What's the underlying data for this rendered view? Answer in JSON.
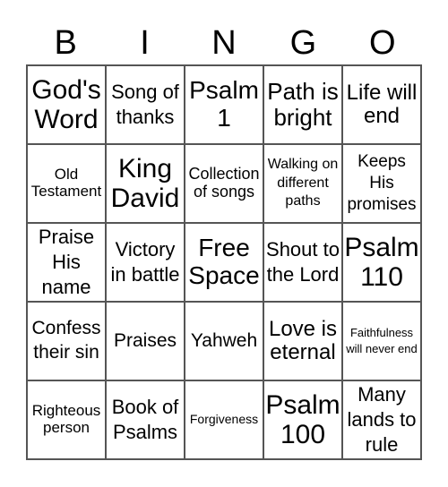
{
  "header": [
    "B",
    "I",
    "N",
    "G",
    "O"
  ],
  "cells": [
    "God's Word",
    "Song of thanks",
    "Psalm 1",
    "Path is bright",
    "Life will end",
    "Old Testament",
    "King David",
    "Collection of songs",
    "Walking on different paths",
    "Keeps His promises",
    "Praise His name",
    "Victory in battle",
    "Free Space",
    "Shout to the Lord",
    "Psalm 110",
    "Confess their sin",
    "Praises",
    "Yahweh",
    "Love is eternal",
    "Faithfulness will never end",
    "Righteous person",
    "Book of Psalms",
    "Forgiveness",
    "Psalm 100",
    "Many lands to rule"
  ]
}
